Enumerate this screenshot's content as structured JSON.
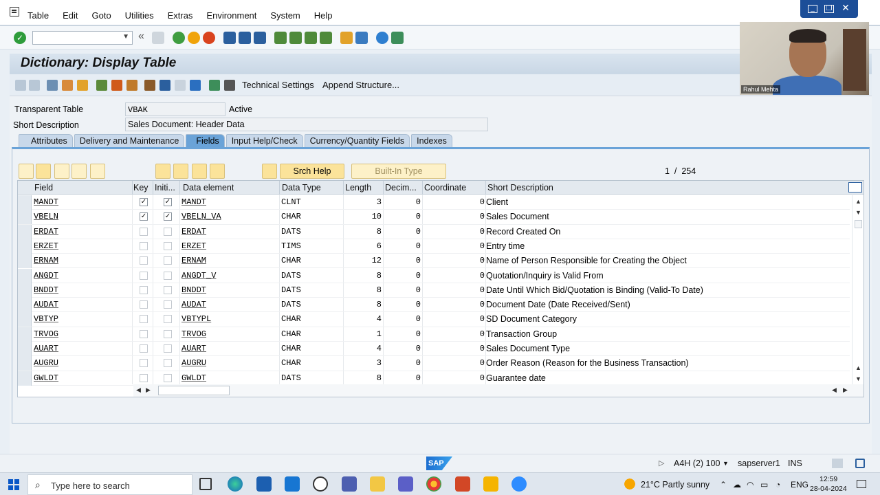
{
  "menu": [
    "Table",
    "Edit",
    "Goto",
    "Utilities",
    "Extras",
    "Environment",
    "System",
    "Help"
  ],
  "window_controls": [
    "minimize-icon",
    "restore-icon",
    "close-icon"
  ],
  "title": "Dictionary: Display Table",
  "app_toolbar": {
    "technical_settings": "Technical Settings",
    "append_structure": "Append Structure..."
  },
  "header": {
    "table_label": "Transparent Table",
    "table_value": "VBAK",
    "status": "Active",
    "desc_label": "Short Description",
    "desc_value": "Sales Document: Header Data"
  },
  "tabs": [
    {
      "label": "Attributes",
      "active": false
    },
    {
      "label": "Delivery and Maintenance",
      "active": false
    },
    {
      "label": "Fields",
      "active": true
    },
    {
      "label": "Input Help/Check",
      "active": false
    },
    {
      "label": "Currency/Quantity Fields",
      "active": false
    },
    {
      "label": "Indexes",
      "active": false
    }
  ],
  "grid_toolbar": {
    "srch_help": "Srch Help",
    "built_in_type": "Built-In Type",
    "page_current": "1",
    "page_sep": "/",
    "page_total": "254"
  },
  "columns": [
    "Field",
    "Key",
    "Initi...",
    "Data element",
    "Data Type",
    "Length",
    "Decim...",
    "Coordinate",
    "Short Description"
  ],
  "rows": [
    {
      "field": "MANDT",
      "key": true,
      "init": true,
      "elem": "MANDT",
      "type": "CLNT",
      "len": "3",
      "dec": "0",
      "coord": "0",
      "desc": "Client"
    },
    {
      "field": "VBELN",
      "key": true,
      "init": true,
      "elem": "VBELN_VA",
      "type": "CHAR",
      "len": "10",
      "dec": "0",
      "coord": "0",
      "desc": "Sales Document"
    },
    {
      "field": "ERDAT",
      "key": false,
      "init": false,
      "elem": "ERDAT",
      "type": "DATS",
      "len": "8",
      "dec": "0",
      "coord": "0",
      "desc": "Record Created On"
    },
    {
      "field": "ERZET",
      "key": false,
      "init": false,
      "elem": "ERZET",
      "type": "TIMS",
      "len": "6",
      "dec": "0",
      "coord": "0",
      "desc": "Entry time"
    },
    {
      "field": "ERNAM",
      "key": false,
      "init": false,
      "elem": "ERNAM",
      "type": "CHAR",
      "len": "12",
      "dec": "0",
      "coord": "0",
      "desc": "Name of Person Responsible for Creating the Object"
    },
    {
      "field": "ANGDT",
      "key": false,
      "init": false,
      "elem": "ANGDT_V",
      "type": "DATS",
      "len": "8",
      "dec": "0",
      "coord": "0",
      "desc": "Quotation/Inquiry is Valid From"
    },
    {
      "field": "BNDDT",
      "key": false,
      "init": false,
      "elem": "BNDDT",
      "type": "DATS",
      "len": "8",
      "dec": "0",
      "coord": "0",
      "desc": "Date Until Which Bid/Quotation is Binding (Valid-To Date)"
    },
    {
      "field": "AUDAT",
      "key": false,
      "init": false,
      "elem": "AUDAT",
      "type": "DATS",
      "len": "8",
      "dec": "0",
      "coord": "0",
      "desc": "Document Date (Date Received/Sent)"
    },
    {
      "field": "VBTYP",
      "key": false,
      "init": false,
      "elem": "VBTYPL",
      "type": "CHAR",
      "len": "4",
      "dec": "0",
      "coord": "0",
      "desc": "SD Document Category"
    },
    {
      "field": "TRVOG",
      "key": false,
      "init": false,
      "elem": "TRVOG",
      "type": "CHAR",
      "len": "1",
      "dec": "0",
      "coord": "0",
      "desc": "Transaction Group"
    },
    {
      "field": "AUART",
      "key": false,
      "init": false,
      "elem": "AUART",
      "type": "CHAR",
      "len": "4",
      "dec": "0",
      "coord": "0",
      "desc": "Sales Document Type"
    },
    {
      "field": "AUGRU",
      "key": false,
      "init": false,
      "elem": "AUGRU",
      "type": "CHAR",
      "len": "3",
      "dec": "0",
      "coord": "0",
      "desc": "Order Reason (Reason for the Business Transaction)"
    },
    {
      "field": "GWLDT",
      "key": false,
      "init": false,
      "elem": "GWLDT",
      "type": "DATS",
      "len": "8",
      "dec": "0",
      "coord": "0",
      "desc": "Guarantee date"
    }
  ],
  "status_bar": {
    "logo": "SAP",
    "system": "A4H (2) 100",
    "server": "sapserver1",
    "mode": "INS"
  },
  "taskbar": {
    "search_placeholder": "Type here to search",
    "weather": "21°C  Partly sunny",
    "lang": "ENG",
    "time": "12:59",
    "date": "28-04-2024"
  },
  "webcam": {
    "name": "Rahul Mehta"
  }
}
